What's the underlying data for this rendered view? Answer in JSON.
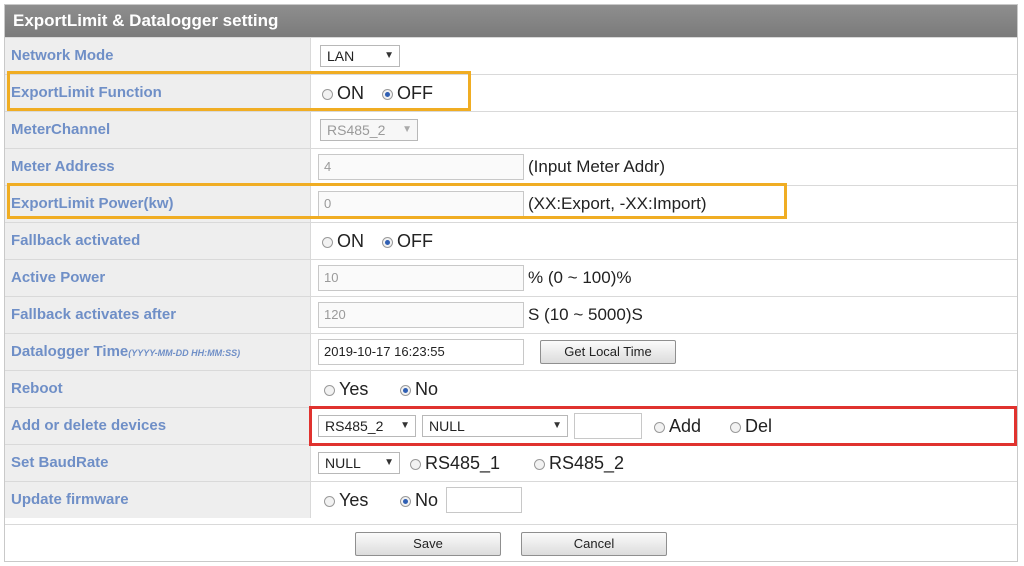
{
  "title": "ExportLimit & Datalogger setting",
  "rows": {
    "network_mode": {
      "label": "Network Mode",
      "value": "LAN"
    },
    "exportlimit_function": {
      "label": "ExportLimit Function",
      "opt_on": "ON",
      "opt_off": "OFF",
      "selected": "OFF"
    },
    "meter_channel": {
      "label": "MeterChannel",
      "value": "RS485_2"
    },
    "meter_address": {
      "label": "Meter Address",
      "value": "4",
      "note": "(Input Meter Addr)"
    },
    "exportlimit_power": {
      "label": "ExportLimit Power(kw)",
      "value": "0",
      "note": "(XX:Export, -XX:Import)"
    },
    "fallback_activated": {
      "label": "Fallback activated",
      "opt_on": "ON",
      "opt_off": "OFF",
      "selected": "OFF"
    },
    "active_power": {
      "label": "Active Power",
      "value": "10",
      "note": "% (0 ~ 100)%"
    },
    "fallback_after": {
      "label": "Fallback activates after",
      "value": "120",
      "note": "S (10 ~ 5000)S"
    },
    "datalogger_time": {
      "label": "Datalogger Time",
      "label_format": "(YYYY-MM-DD HH:MM:SS)",
      "value": "2019-10-17 16:23:55",
      "button": "Get Local Time"
    },
    "reboot": {
      "label": "Reboot",
      "opt_yes": "Yes",
      "opt_no": "No",
      "selected": "No"
    },
    "add_delete": {
      "label": "Add or delete devices",
      "port": "RS485_2",
      "device": "NULL",
      "address": "",
      "opt_add": "Add",
      "opt_del": "Del"
    },
    "baud_rate": {
      "label": "Set BaudRate",
      "value": "NULL",
      "opt_1": "RS485_1",
      "opt_2": "RS485_2"
    },
    "update_firmware": {
      "label": "Update firmware",
      "opt_yes": "Yes",
      "opt_no": "No",
      "selected": "No"
    }
  },
  "footer": {
    "save": "Save",
    "cancel": "Cancel"
  },
  "colors": {
    "highlight_orange": "#f0ad23",
    "highlight_red": "#e0322e",
    "label_text": "#6f8fc7",
    "title_bar": "#858585"
  }
}
